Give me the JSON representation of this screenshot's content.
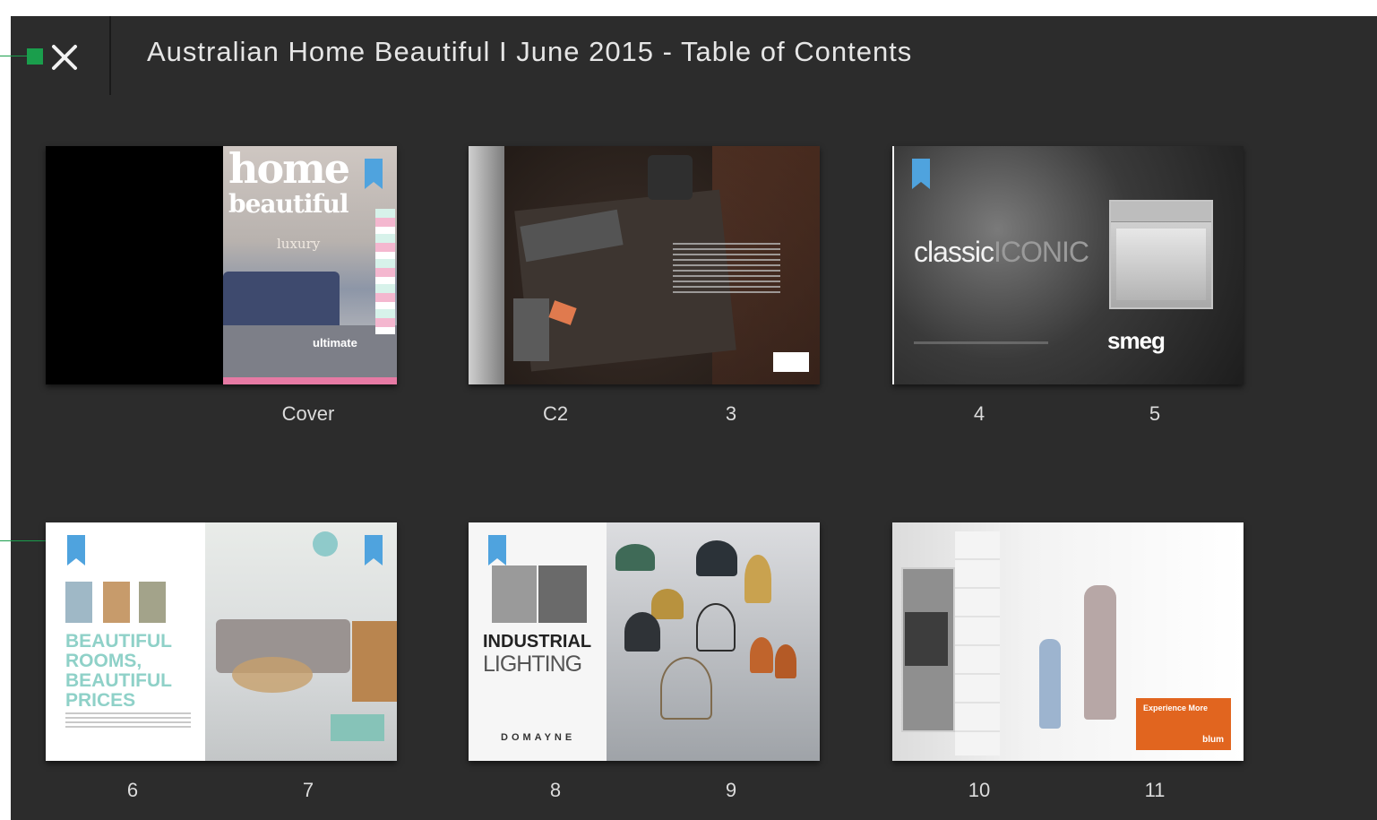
{
  "header": {
    "title": "Australian Home Beautiful I June 2015 - Table of Contents",
    "close_icon": "close-icon"
  },
  "spreads": [
    {
      "id": "cover",
      "left_label": "",
      "right_label": "Cover",
      "bookmarked": "right"
    },
    {
      "id": "c2-3",
      "left_label": "C2",
      "right_label": "3",
      "bookmarked": "none"
    },
    {
      "id": "4-5",
      "left_label": "4",
      "right_label": "5",
      "bookmarked": "left"
    },
    {
      "id": "6-7",
      "left_label": "6",
      "right_label": "7",
      "bookmarked": "both"
    },
    {
      "id": "8-9",
      "left_label": "8",
      "right_label": "9",
      "bookmarked": "left"
    },
    {
      "id": "10-11",
      "left_label": "10",
      "right_label": "11",
      "bookmarked": "none"
    }
  ],
  "cover": {
    "brand_line1": "home",
    "brand_line2": "beautiful",
    "tag": "ultimate",
    "lux": "luxury"
  },
  "spread_4_5": {
    "word_a": "classic",
    "word_b": "ICONIC",
    "brand": "smeg"
  },
  "spread_6_7": {
    "headline": [
      "BEAUTIFUL",
      "ROOMS,",
      "BEAUTIFUL",
      "PRICES"
    ]
  },
  "spread_8_9": {
    "word_a": "INDUSTRIAL",
    "word_b": "LIGHTING",
    "brand": "DOMAYNE"
  },
  "spread_10_11": {
    "ad_text": "Experience More",
    "brand": "blum"
  },
  "colors": {
    "background": "#2c2c2c",
    "bookmark": "#4fa3de",
    "annotation": "#1a9e4c"
  }
}
